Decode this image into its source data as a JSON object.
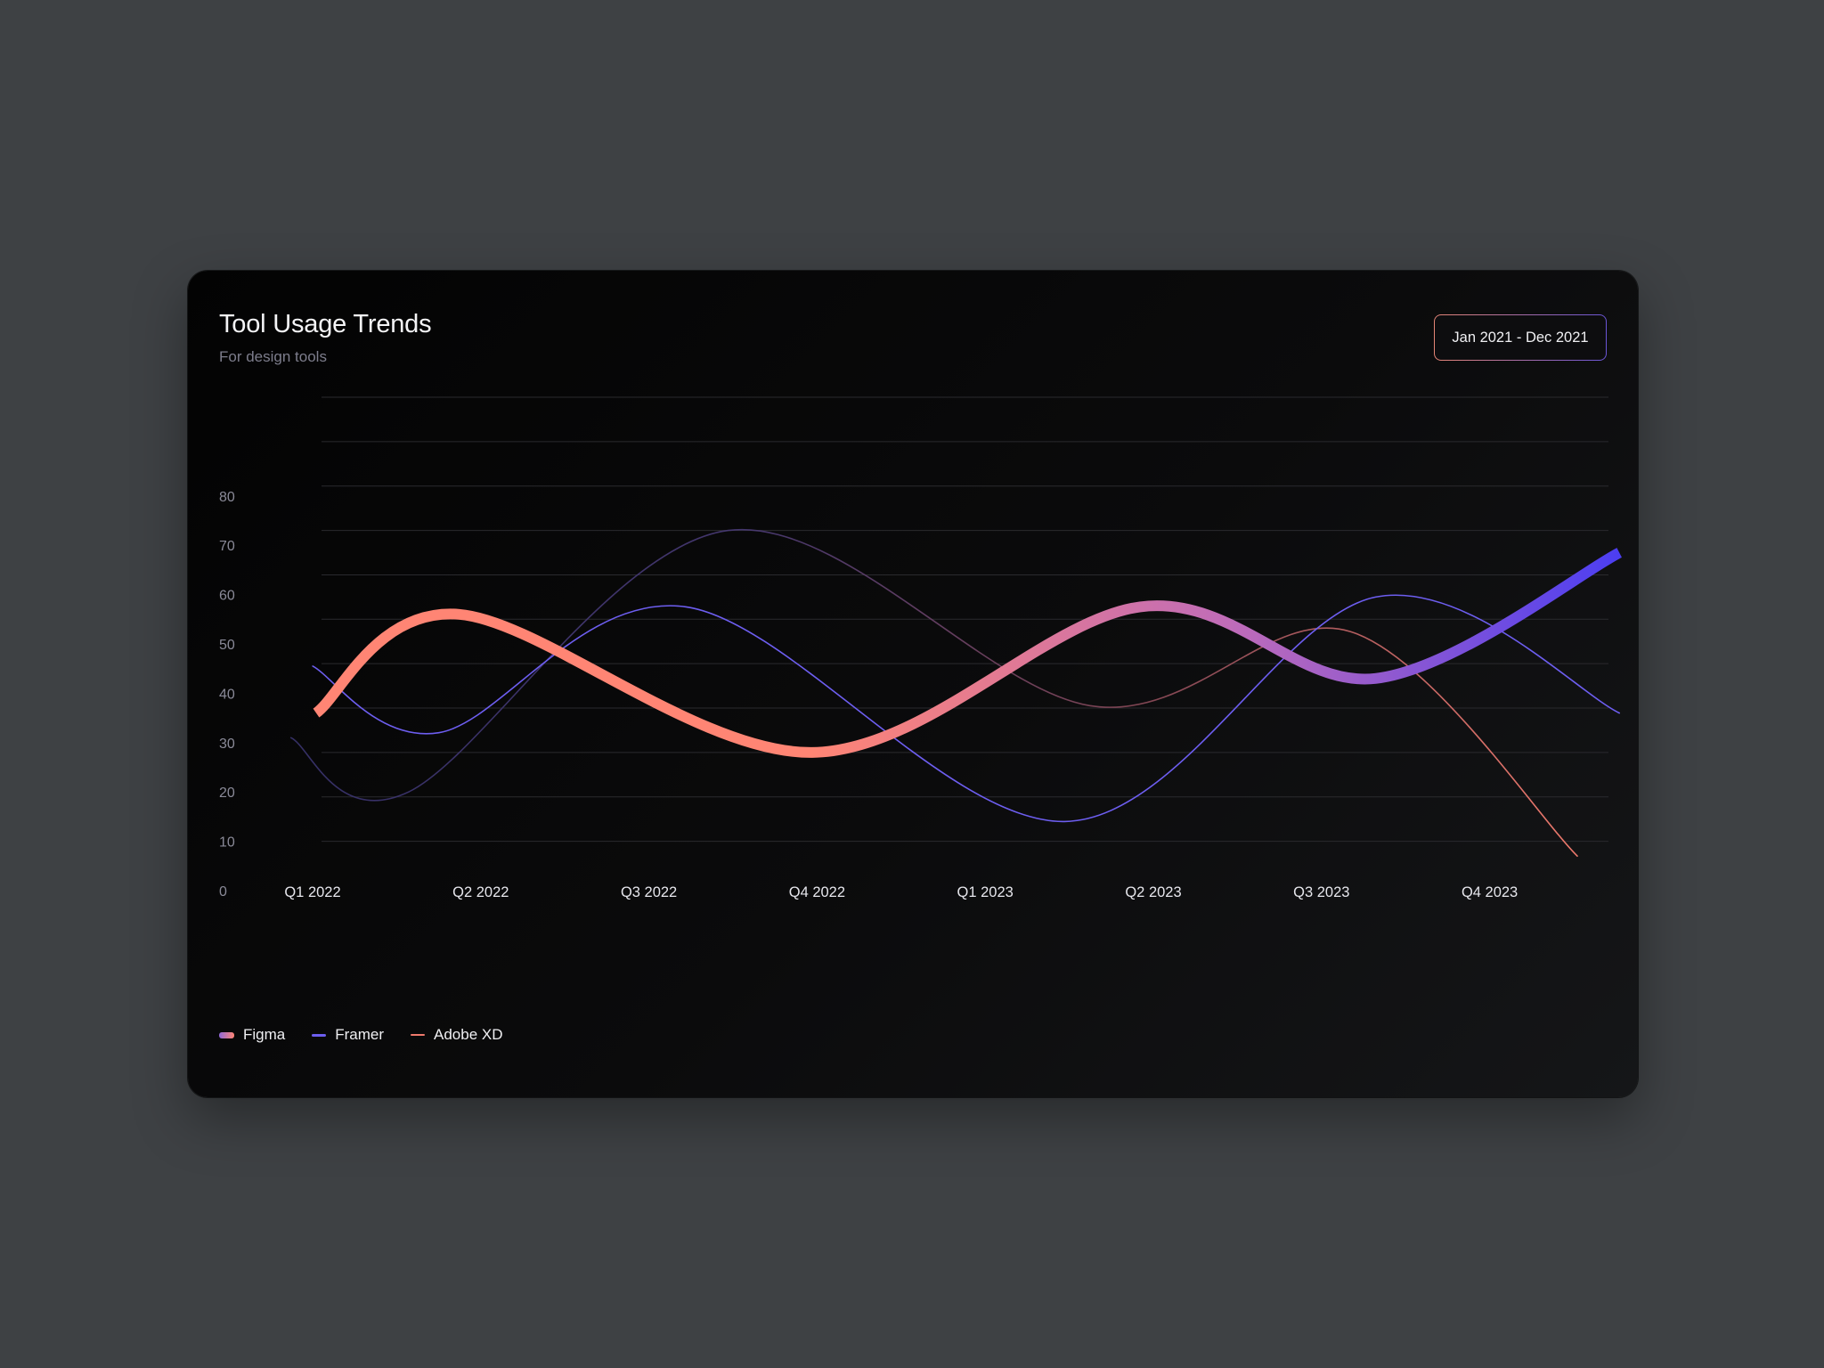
{
  "card": {
    "title": "Tool Usage Trends",
    "subtitle": "For design tools",
    "range_label": "Jan 2021 - Dec 2021"
  },
  "colors": {
    "figma_start": "#ff8574",
    "figma_mid": "#c06cb8",
    "figma_end": "#4c3ef2",
    "framer": "#6d5ef0",
    "adobe_xd": "#ef7a6d",
    "axis_text": "#8a8a98",
    "gridline": "#2a2a2e"
  },
  "icons": {
    "figma_swatch": "gradient-pill",
    "framer_swatch": "line",
    "adobe_xd_swatch": "line"
  },
  "chart_data": {
    "type": "line",
    "categories": [
      "Q1 2022",
      "Q2 2022",
      "Q3 2022",
      "Q4 2022",
      "Q1 2023",
      "Q2 2023",
      "Q3 2023",
      "Q4 2023"
    ],
    "yticks": [
      0,
      10,
      20,
      30,
      40,
      50,
      60,
      70,
      80
    ],
    "ylim": [
      0,
      80
    ],
    "grid": true,
    "legend_position": "bottom-left",
    "series": [
      {
        "name": "Figma",
        "style": "thick-gradient",
        "points": [
          [
            0.0,
            36
          ],
          [
            0.85,
            56
          ],
          [
            2.95,
            28
          ],
          [
            4.9,
            57.5
          ],
          [
            6.3,
            43
          ],
          [
            7.75,
            68.5
          ]
        ]
      },
      {
        "name": "Framer",
        "style": "thin",
        "points": [
          [
            -0.02,
            45.5
          ],
          [
            0.73,
            32
          ],
          [
            2.2,
            57.5
          ],
          [
            4.45,
            14
          ],
          [
            6.3,
            59.5
          ],
          [
            7.75,
            36
          ]
        ]
      },
      {
        "name": "Adobe XD",
        "style": "thin-faded",
        "points": [
          [
            -0.15,
            31
          ],
          [
            0.55,
            20
          ],
          [
            2.45,
            73
          ],
          [
            4.6,
            37.5
          ],
          [
            6.15,
            52.5
          ],
          [
            7.5,
            7
          ]
        ]
      }
    ]
  }
}
